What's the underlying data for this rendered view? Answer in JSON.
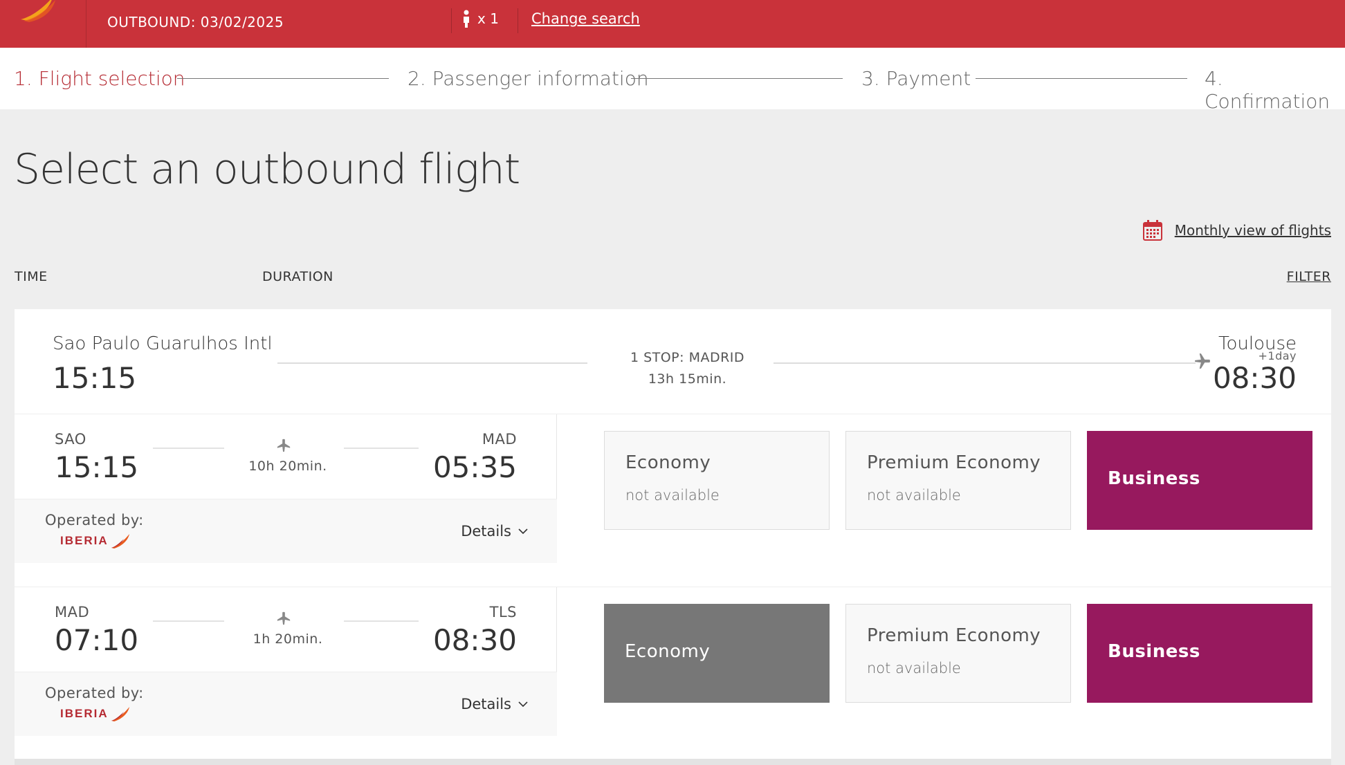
{
  "header": {
    "outbound": "OUTBOUND: 03/02/2025",
    "passengers": "x 1",
    "change_search": "Change search"
  },
  "stepper": {
    "steps": [
      "1. Flight selection",
      "2. Passenger information",
      "3. Payment",
      "4. Confirmation"
    ]
  },
  "page": {
    "title": "Select an outbound flight",
    "monthly_view": "Monthly view of flights",
    "col_time": "TIME",
    "col_duration": "DURATION",
    "filter": "FILTER"
  },
  "summary": {
    "origin": "Sao Paulo Guarulhos Intl",
    "departure_time": "15:15",
    "stop": "1 STOP: MADRID",
    "total_duration": "13h 15min.",
    "destination": "Toulouse",
    "next_day": "+1day",
    "arrival_time": "08:30"
  },
  "segments": [
    {
      "from_code": "SAO",
      "from_time": "15:15",
      "duration": "10h 20min.",
      "to_code": "MAD",
      "to_time": "05:35",
      "operated_by": "Operated by:",
      "airline": "IBERIA",
      "details": "Details",
      "fares": {
        "economy": {
          "name": "Economy",
          "status": "not available"
        },
        "premium": {
          "name": "Premium Economy",
          "status": "not available"
        },
        "business": {
          "name": "Business"
        }
      }
    },
    {
      "from_code": "MAD",
      "from_time": "07:10",
      "duration": "1h 20min.",
      "to_code": "TLS",
      "to_time": "08:30",
      "operated_by": "Operated by:",
      "airline": "IBERIA",
      "details": "Details",
      "fares": {
        "economy": {
          "name": "Economy"
        },
        "premium": {
          "name": "Premium Economy",
          "status": "not available"
        },
        "business": {
          "name": "Business"
        }
      }
    }
  ],
  "colors": {
    "brand_red": "#c9323a",
    "business": "#97195e",
    "economy_selected": "#777777"
  }
}
